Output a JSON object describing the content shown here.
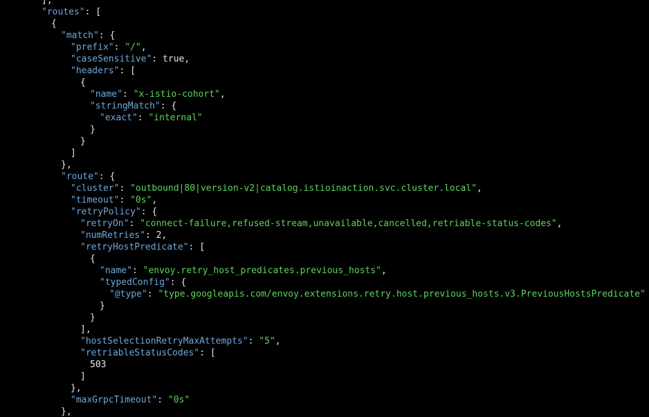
{
  "lines": [
    {
      "tokens": [
        {
          "t": "p",
          "v": "],"
        }
      ]
    },
    {
      "tokens": [
        {
          "t": "k",
          "v": "\"routes\""
        },
        {
          "t": "p",
          "v": ": ["
        }
      ]
    },
    {
      "tokens": [
        {
          "t": "p",
          "v": "{"
        }
      ]
    },
    {
      "tokens": [
        {
          "t": "k",
          "v": "\"match\""
        },
        {
          "t": "p",
          "v": ": {"
        }
      ]
    },
    {
      "tokens": [
        {
          "t": "k",
          "v": "\"prefix\""
        },
        {
          "t": "p",
          "v": ": "
        },
        {
          "t": "s",
          "v": "\"/\""
        },
        {
          "t": "p",
          "v": ","
        }
      ]
    },
    {
      "tokens": [
        {
          "t": "k",
          "v": "\"caseSensitive\""
        },
        {
          "t": "p",
          "v": ": true,"
        }
      ]
    },
    {
      "tokens": [
        {
          "t": "k",
          "v": "\"headers\""
        },
        {
          "t": "p",
          "v": ": ["
        }
      ]
    },
    {
      "tokens": [
        {
          "t": "p",
          "v": "{"
        }
      ]
    },
    {
      "tokens": [
        {
          "t": "k",
          "v": "\"name\""
        },
        {
          "t": "p",
          "v": ": "
        },
        {
          "t": "s",
          "v": "\"x-istio-cohort\""
        },
        {
          "t": "p",
          "v": ","
        }
      ]
    },
    {
      "tokens": [
        {
          "t": "k",
          "v": "\"stringMatch\""
        },
        {
          "t": "p",
          "v": ": {"
        }
      ]
    },
    {
      "tokens": [
        {
          "t": "k",
          "v": "\"exact\""
        },
        {
          "t": "p",
          "v": ": "
        },
        {
          "t": "s",
          "v": "\"internal\""
        }
      ]
    },
    {
      "tokens": [
        {
          "t": "p",
          "v": "}"
        }
      ]
    },
    {
      "tokens": [
        {
          "t": "p",
          "v": "}"
        }
      ]
    },
    {
      "tokens": [
        {
          "t": "p",
          "v": "]"
        }
      ]
    },
    {
      "tokens": [
        {
          "t": "p",
          "v": "},"
        }
      ]
    },
    {
      "tokens": [
        {
          "t": "k",
          "v": "\"route\""
        },
        {
          "t": "p",
          "v": ": {"
        }
      ]
    },
    {
      "tokens": [
        {
          "t": "k",
          "v": "\"cluster\""
        },
        {
          "t": "p",
          "v": ": "
        },
        {
          "t": "s",
          "v": "\"outbound|80|version-v2|catalog.istioinaction.svc.cluster.local\""
        },
        {
          "t": "p",
          "v": ","
        }
      ]
    },
    {
      "tokens": [
        {
          "t": "k",
          "v": "\"timeout\""
        },
        {
          "t": "p",
          "v": ": "
        },
        {
          "t": "s",
          "v": "\"0s\""
        },
        {
          "t": "p",
          "v": ","
        }
      ]
    },
    {
      "tokens": [
        {
          "t": "k",
          "v": "\"retryPolicy\""
        },
        {
          "t": "p",
          "v": ": {"
        }
      ]
    },
    {
      "tokens": [
        {
          "t": "k",
          "v": "\"retryOn\""
        },
        {
          "t": "p",
          "v": ": "
        },
        {
          "t": "s",
          "v": "\"connect-failure,refused-stream,unavailable,cancelled,retriable-status-codes\""
        },
        {
          "t": "p",
          "v": ","
        }
      ]
    },
    {
      "tokens": [
        {
          "t": "k",
          "v": "\"numRetries\""
        },
        {
          "t": "p",
          "v": ": 2,"
        }
      ]
    },
    {
      "tokens": [
        {
          "t": "k",
          "v": "\"retryHostPredicate\""
        },
        {
          "t": "p",
          "v": ": ["
        }
      ]
    },
    {
      "tokens": [
        {
          "t": "p",
          "v": "{"
        }
      ]
    },
    {
      "tokens": [
        {
          "t": "k",
          "v": "\"name\""
        },
        {
          "t": "p",
          "v": ": "
        },
        {
          "t": "s",
          "v": "\"envoy.retry_host_predicates.previous_hosts\""
        },
        {
          "t": "p",
          "v": ","
        }
      ]
    },
    {
      "tokens": [
        {
          "t": "k",
          "v": "\"typedConfig\""
        },
        {
          "t": "p",
          "v": ": {"
        }
      ]
    },
    {
      "tokens": [
        {
          "t": "k",
          "v": "\"@type\""
        },
        {
          "t": "p",
          "v": ": "
        },
        {
          "t": "s",
          "v": "\"type.googleapis.com/envoy.extensions.retry.host.previous_hosts.v3.PreviousHostsPredicate\""
        }
      ]
    },
    {
      "tokens": [
        {
          "t": "p",
          "v": "}"
        }
      ]
    },
    {
      "tokens": [
        {
          "t": "p",
          "v": "}"
        }
      ]
    },
    {
      "tokens": [
        {
          "t": "p",
          "v": "],"
        }
      ]
    },
    {
      "tokens": [
        {
          "t": "k",
          "v": "\"hostSelectionRetryMaxAttempts\""
        },
        {
          "t": "p",
          "v": ": "
        },
        {
          "t": "s",
          "v": "\"5\""
        },
        {
          "t": "p",
          "v": ","
        }
      ]
    },
    {
      "tokens": [
        {
          "t": "k",
          "v": "\"retriableStatusCodes\""
        },
        {
          "t": "p",
          "v": ": ["
        }
      ]
    },
    {
      "tokens": [
        {
          "t": "p",
          "v": "503"
        }
      ]
    },
    {
      "tokens": [
        {
          "t": "p",
          "v": "]"
        }
      ]
    },
    {
      "tokens": [
        {
          "t": "p",
          "v": "},"
        }
      ]
    },
    {
      "tokens": [
        {
          "t": "k",
          "v": "\"maxGrpcTimeout\""
        },
        {
          "t": "p",
          "v": ": "
        },
        {
          "t": "s",
          "v": "\"0s\""
        }
      ]
    },
    {
      "tokens": [
        {
          "t": "p",
          "v": "},"
        }
      ]
    }
  ]
}
